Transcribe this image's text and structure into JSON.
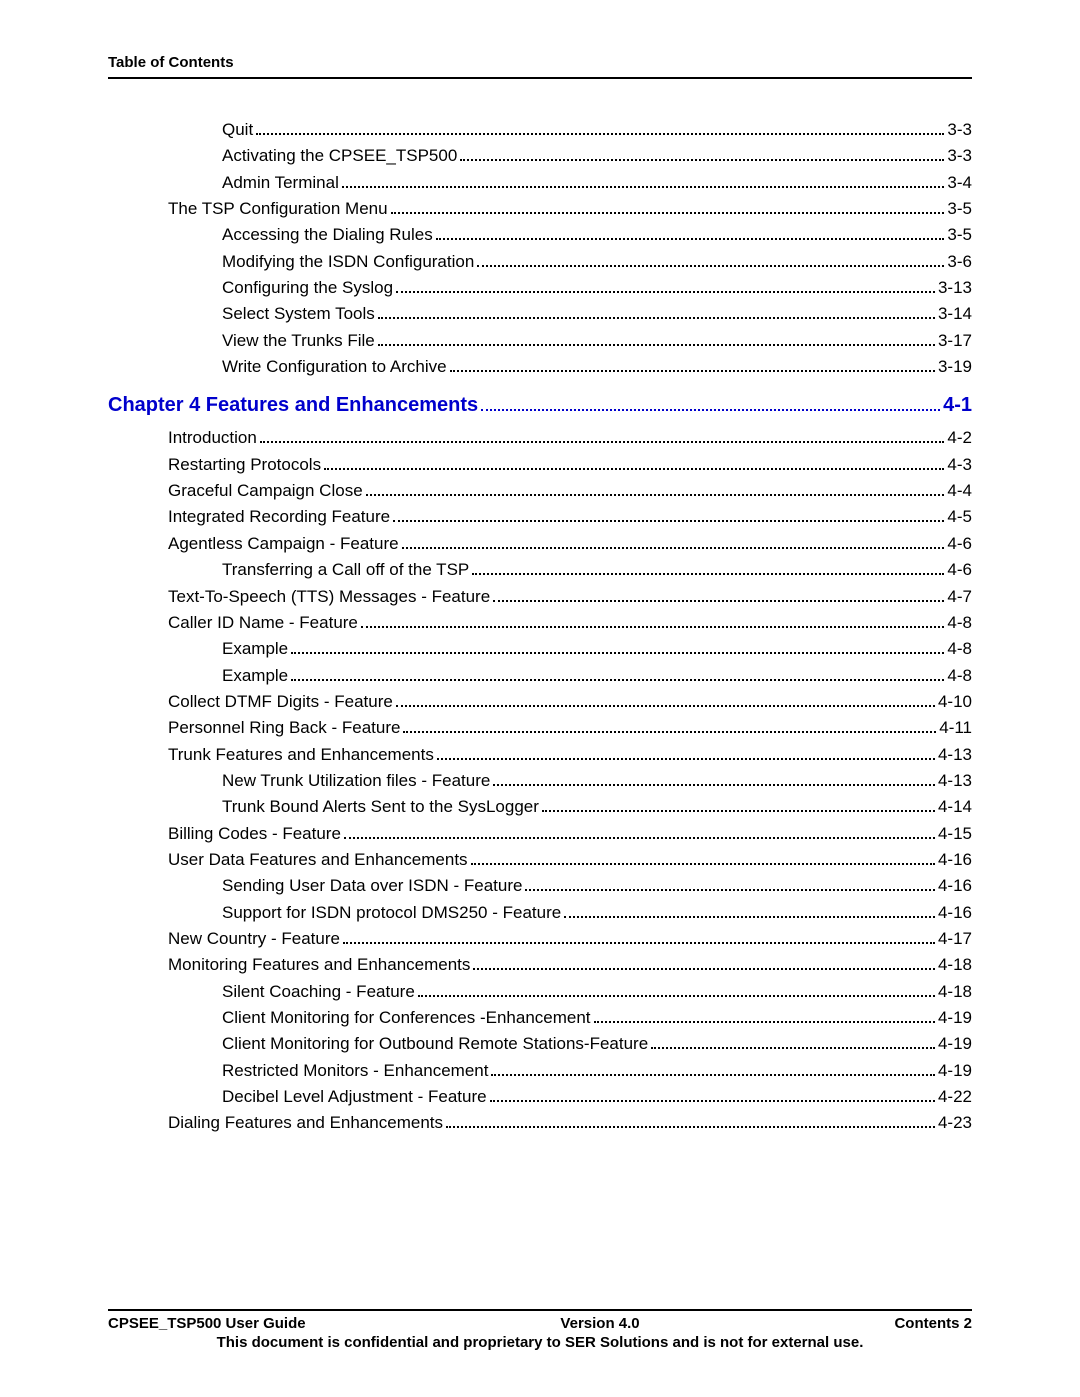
{
  "header": "Table of Contents",
  "toc": [
    {
      "level": 2,
      "label": "Quit",
      "page": "3-3"
    },
    {
      "level": 2,
      "label": "Activating the CPSEE_TSP500",
      "page": "3-3"
    },
    {
      "level": 2,
      "label": "Admin Terminal",
      "page": "3-4"
    },
    {
      "level": 1,
      "label": "The TSP Configuration Menu",
      "page": "3-5"
    },
    {
      "level": 2,
      "label": "Accessing the Dialing Rules",
      "page": "3-5"
    },
    {
      "level": 2,
      "label": "Modifying the ISDN Configuration",
      "page": "3-6"
    },
    {
      "level": 2,
      "label": "Configuring the Syslog",
      "page": "3-13"
    },
    {
      "level": 2,
      "label": "Select System Tools",
      "page": "3-14"
    },
    {
      "level": 2,
      "label": "View the Trunks File",
      "page": "3-17"
    },
    {
      "level": 2,
      "label": " Write Configuration to Archive",
      "page": "3-19"
    },
    {
      "level": "chapter",
      "label": "Chapter 4  Features and Enhancements",
      "page": "4-1"
    },
    {
      "level": 1,
      "label": "Introduction",
      "page": "4-2"
    },
    {
      "level": 1,
      "label": " Restarting Protocols",
      "page": "4-3"
    },
    {
      "level": 1,
      "label": "Graceful Campaign Close",
      "page": "4-4"
    },
    {
      "level": 1,
      "label": "Integrated Recording Feature",
      "page": "4-5"
    },
    {
      "level": 1,
      "label": "Agentless Campaign - Feature",
      "page": "4-6"
    },
    {
      "level": 2,
      "label": "Transferring a Call off of the TSP",
      "page": "4-6"
    },
    {
      "level": 1,
      "label": "Text-To-Speech (TTS) Messages - Feature",
      "page": "4-7"
    },
    {
      "level": 1,
      "label": "Caller ID Name - Feature",
      "page": "4-8"
    },
    {
      "level": 2,
      "label": "Example",
      "page": "4-8"
    },
    {
      "level": 2,
      "label": "Example",
      "page": "4-8"
    },
    {
      "level": 1,
      "label": "Collect DTMF Digits - Feature",
      "page": "4-10"
    },
    {
      "level": 1,
      "label": "Personnel Ring Back - Feature",
      "page": "4-11"
    },
    {
      "level": 1,
      "label": "Trunk Features and Enhancements",
      "page": "4-13"
    },
    {
      "level": 2,
      "label": "New Trunk Utilization files - Feature",
      "page": "4-13"
    },
    {
      "level": 2,
      "label": "Trunk Bound Alerts Sent to the SysLogger",
      "page": "4-14"
    },
    {
      "level": 1,
      "label": "Billing Codes - Feature",
      "page": "4-15"
    },
    {
      "level": 1,
      "label": "User Data Features and Enhancements",
      "page": "4-16"
    },
    {
      "level": 2,
      "label": "Sending User Data over ISDN - Feature",
      "page": "4-16"
    },
    {
      "level": 2,
      "label": "Support for ISDN protocol DMS250 - Feature",
      "page": "4-16"
    },
    {
      "level": 1,
      "label": "New Country - Feature",
      "page": "4-17"
    },
    {
      "level": 1,
      "label": "Monitoring Features and Enhancements",
      "page": "4-18"
    },
    {
      "level": 2,
      "label": "Silent Coaching - Feature",
      "page": "4-18"
    },
    {
      "level": 2,
      "label": "Client Monitoring for Conferences -Enhancement",
      "page": "4-19"
    },
    {
      "level": 2,
      "label": "Client Monitoring for Outbound Remote Stations-Feature",
      "page": "4-19"
    },
    {
      "level": 2,
      "label": "Restricted Monitors - Enhancement",
      "page": "4-19"
    },
    {
      "level": 2,
      "label": "Decibel Level Adjustment - Feature",
      "page": "4-22"
    },
    {
      "level": 1,
      "label": "Dialing Features and Enhancements",
      "page": "4-23"
    }
  ],
  "footer": {
    "left": "CPSEE_TSP500 User Guide",
    "center": "Version 4.0",
    "right": "Contents 2",
    "note": "This document is confidential and proprietary to SER Solutions and is not for external use."
  }
}
